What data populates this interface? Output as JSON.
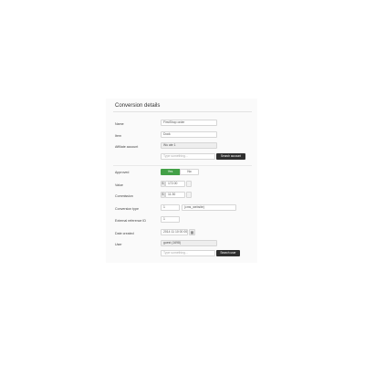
{
  "title": "Conversion details",
  "labels": {
    "name": "Name",
    "item": "Item",
    "affiliate_account": "Affiliate account",
    "approved": "Approved",
    "value": "Value",
    "commission": "Commission",
    "conversion_type": "Conversion type",
    "external_reference_id": "External reference ID",
    "date_created": "Date created",
    "user": "User"
  },
  "fields": {
    "name_value": "FirstShop order",
    "item_value": "Dock",
    "affiliate_value": "Wu ate 1",
    "affiliate_search_placeholder": "Type something...",
    "value_currency": "$",
    "value_amount": "172.00",
    "commission_currency": "$",
    "commission_amount": "11.30",
    "conversion_type_id": "1",
    "conversion_type_name": "(cms_website)",
    "external_reference_id": "1",
    "date_created": "2014 11 10 00 00",
    "user_value": "guest (1698)",
    "user_search_placeholder": "Type something..."
  },
  "buttons": {
    "search_account": "Search account",
    "search_user": "Search user"
  },
  "toggle": {
    "yes": "Yes",
    "no": "No",
    "selected": "Yes"
  },
  "colors": {
    "toggle_active": "#43a047",
    "dark_button": "#2f2f2f"
  },
  "icons": {
    "calendar": "calendar-icon"
  }
}
